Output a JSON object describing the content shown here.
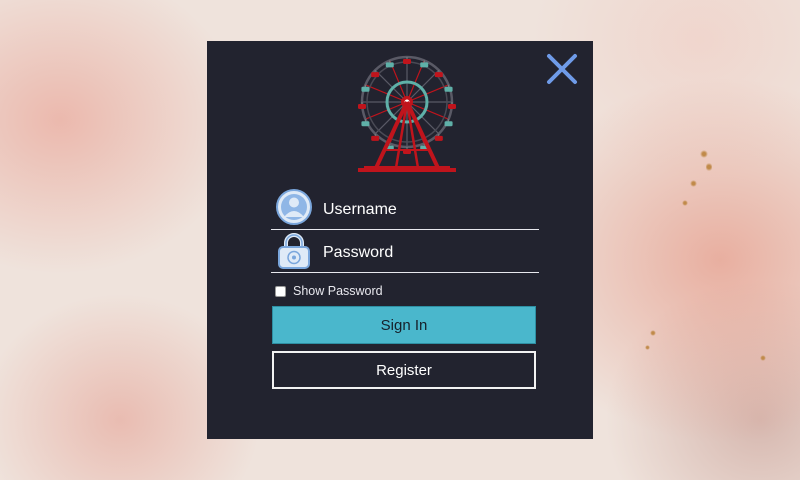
{
  "window": {
    "close_icon": "close-icon",
    "logo_icon": "ferris-wheel-icon"
  },
  "form": {
    "username": {
      "placeholder": "Username",
      "value": "",
      "icon": "user-icon"
    },
    "password": {
      "placeholder": "Password",
      "value": "",
      "icon": "lock-icon"
    },
    "show_password_label": "Show Password",
    "show_password_checked": false,
    "signin_label": "Sign In",
    "register_label": "Register"
  },
  "colors": {
    "panel_bg": "#22232f",
    "accent": "#4ab7cc",
    "close_icon": "#6f9be8",
    "wheel_red": "#c0141c",
    "wheel_teal": "#5fb0a8"
  }
}
